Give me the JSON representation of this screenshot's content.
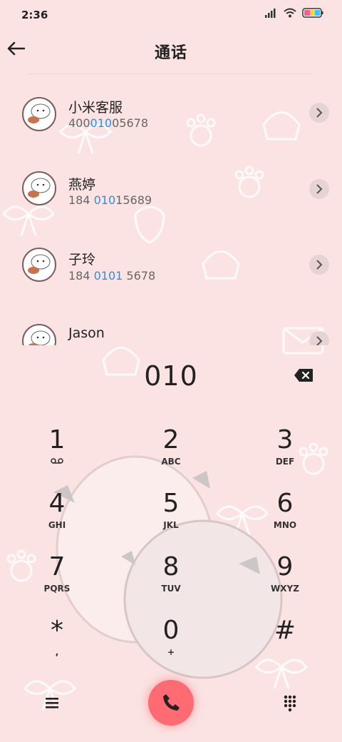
{
  "status_bar": {
    "time": "2:36"
  },
  "header": {
    "title": "通话"
  },
  "contacts": [
    {
      "name": "小米客服",
      "number_pre": "400",
      "number_hl": "010",
      "number_post": "05678"
    },
    {
      "name": "燕婷",
      "number_pre": "184 ",
      "number_hl": "010",
      "number_post": "15689"
    },
    {
      "name": "子玲",
      "number_pre": "184 ",
      "number_hl": "0101",
      "number_post": " 5678"
    },
    {
      "name": "Jason",
      "number_pre": "",
      "number_hl": "",
      "number_post": ""
    }
  ],
  "dialer": {
    "input": "010",
    "keys": [
      {
        "digit": "1",
        "letters": ""
      },
      {
        "digit": "2",
        "letters": "ABC"
      },
      {
        "digit": "3",
        "letters": "DEF"
      },
      {
        "digit": "4",
        "letters": "GHI"
      },
      {
        "digit": "5",
        "letters": "JKL"
      },
      {
        "digit": "6",
        "letters": "MNO"
      },
      {
        "digit": "7",
        "letters": "PQRS"
      },
      {
        "digit": "8",
        "letters": "TUV"
      },
      {
        "digit": "9",
        "letters": "WXYZ"
      },
      {
        "digit": "*",
        "letters": ","
      },
      {
        "digit": "0",
        "letters": "+"
      },
      {
        "digit": "#",
        "letters": ""
      }
    ]
  },
  "colors": {
    "background": "#fbe3e3",
    "highlight": "#2d8fe0",
    "call": "#ff6b72"
  },
  "icons": {
    "back": "arrow-left-icon",
    "backspace": "backspace-icon",
    "menu": "menu-icon",
    "call": "phone-icon",
    "keypad": "keypad-icon",
    "voicemail": "voicemail-icon"
  }
}
